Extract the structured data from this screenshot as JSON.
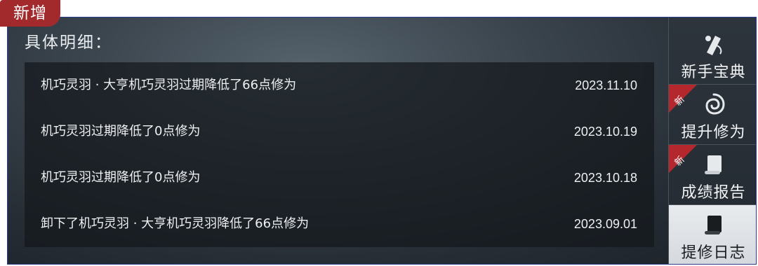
{
  "badge": {
    "label": "新增"
  },
  "section": {
    "title": "具体明细："
  },
  "records": [
    {
      "text": "机巧灵羽 · 大亨机巧灵羽过期降低了66点修为",
      "date": "2023.11.10"
    },
    {
      "text": "机巧灵羽过期降低了0点修为",
      "date": "2023.10.19"
    },
    {
      "text": "机巧灵羽过期降低了0点修为",
      "date": "2023.10.18"
    },
    {
      "text": "卸下了机巧灵羽 · 大亨机巧灵羽降低了66点修为",
      "date": "2023.09.01"
    }
  ],
  "sidebar": {
    "items": [
      {
        "label": "新手宝典",
        "icon": "scroll-quill-icon",
        "new": false,
        "active": false
      },
      {
        "label": "提升修为",
        "icon": "swirl-icon",
        "new": true,
        "new_label": "新",
        "active": false
      },
      {
        "label": "成绩报告",
        "icon": "scroll-icon",
        "new": true,
        "new_label": "新",
        "active": false
      },
      {
        "label": "提修日志",
        "icon": "scroll-icon",
        "new": false,
        "active": true
      }
    ]
  },
  "colors": {
    "badge": "#a32a2c",
    "ribbon": "#b3272d",
    "frame_border": "#2a3c8c"
  }
}
